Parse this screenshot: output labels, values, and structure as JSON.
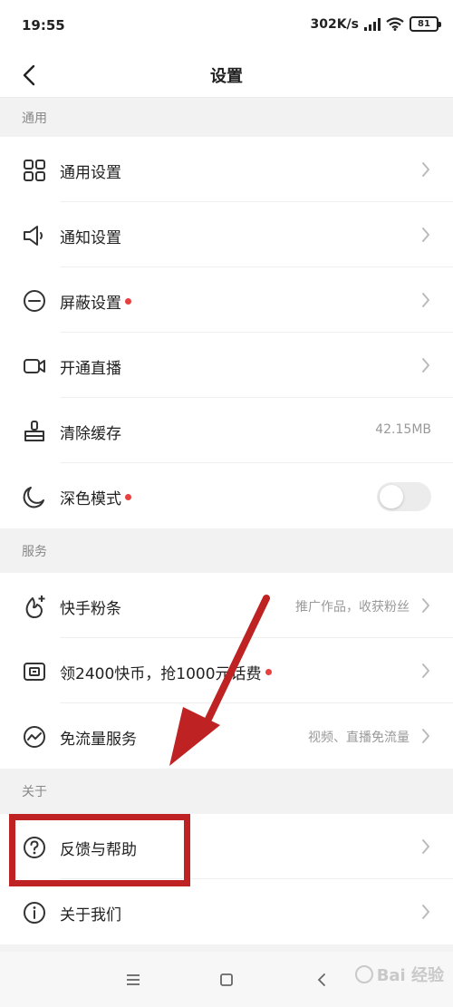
{
  "status_bar": {
    "time": "19:55",
    "net_speed": "302K/s",
    "battery": "81"
  },
  "nav": {
    "title": "设置"
  },
  "sections": {
    "general": "通用",
    "services": "服务",
    "about": "关于"
  },
  "rows": {
    "general_settings": {
      "label": "通用设置",
      "icon": "grid-icon"
    },
    "notify_settings": {
      "label": "通知设置",
      "icon": "speaker-icon"
    },
    "block_settings": {
      "label": "屏蔽设置",
      "icon": "minus-circle-icon",
      "dot": true
    },
    "live_stream": {
      "label": "开通直播",
      "icon": "video-camera-icon"
    },
    "clear_cache": {
      "label": "清除缓存",
      "icon": "broom-icon",
      "value": "42.15MB"
    },
    "dark_mode": {
      "label": "深色模式",
      "icon": "moon-icon",
      "dot": true,
      "toggle_on": false
    },
    "fans": {
      "label": "快手粉条",
      "icon": "fan-strip-icon",
      "value": "推广作品，收获粉丝"
    },
    "coins": {
      "label": "领2400快币，抢1000元话费",
      "icon": "wallet-icon",
      "dot": true
    },
    "free_data": {
      "label": "免流量服务",
      "icon": "wave-circle-icon",
      "value": "视频、直播免流量"
    },
    "feedback": {
      "label": "反馈与帮助",
      "icon": "question-circle-icon"
    },
    "about_us": {
      "label": "关于我们",
      "icon": "info-circle-icon"
    }
  },
  "annotation": {
    "color": "#bf2222"
  },
  "watermark": {
    "text": "Bai 经验"
  }
}
